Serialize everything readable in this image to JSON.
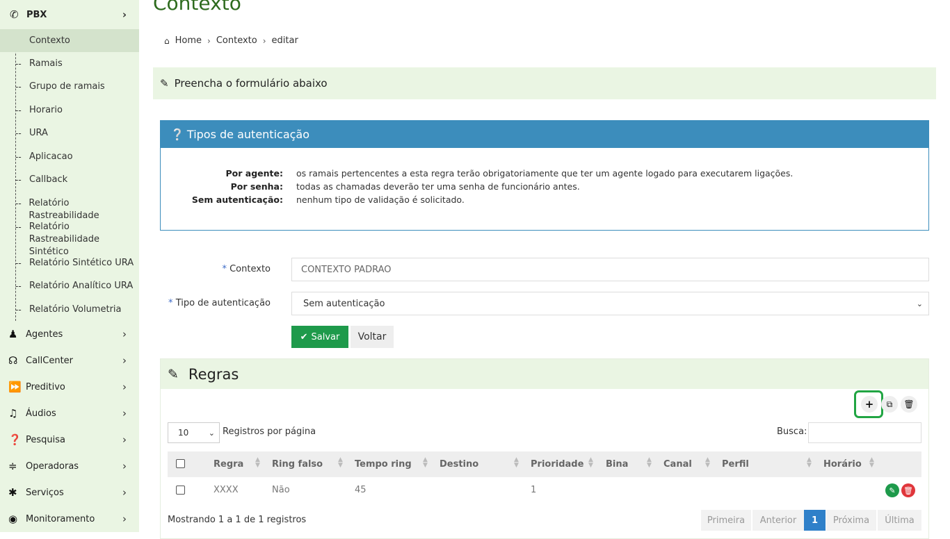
{
  "page_title": "Contexto",
  "breadcrumb": {
    "home": "Home",
    "section": "Contexto",
    "current": "editar"
  },
  "sidebar": {
    "pbx_label": "PBX",
    "sub_items": [
      {
        "label": "Contexto"
      },
      {
        "label": "Ramais"
      },
      {
        "label": "Grupo de ramais"
      },
      {
        "label": "Horario"
      },
      {
        "label": "URA"
      },
      {
        "label": "Aplicacao"
      },
      {
        "label": "Callback"
      },
      {
        "label": "Relatório Rastreabilidade"
      },
      {
        "label": "Relatório Rastreabilidade Sintético"
      },
      {
        "label": "Relatório Sintético URA"
      },
      {
        "label": "Relatório Analítico URA"
      },
      {
        "label": "Relatório Volumetria"
      }
    ],
    "menu_items": [
      {
        "label": "Agentes",
        "icon": "person-icon"
      },
      {
        "label": "CallCenter",
        "icon": "headset-icon"
      },
      {
        "label": "Preditivo",
        "icon": "fast-forward-icon"
      },
      {
        "label": "Áudios",
        "icon": "music-icon"
      },
      {
        "label": "Pesquisa",
        "icon": "question-icon"
      },
      {
        "label": "Operadoras",
        "icon": "rss-icon"
      },
      {
        "label": "Serviços",
        "icon": "asterisk-icon"
      },
      {
        "label": "Monitoramento",
        "icon": "eye-icon"
      }
    ]
  },
  "form_banner": "Preencha o formulário abaixo",
  "auth_info": {
    "title": "Tipos de autenticação",
    "rows": [
      {
        "label": "Por agente:",
        "desc": "os ramais pertencentes a esta regra terão obrigatoriamente que ter um agente logado para executarem ligações."
      },
      {
        "label": "Por senha:",
        "desc": "todas as chamadas deverão ter uma senha de funcionário antes."
      },
      {
        "label": "Sem autenticação:",
        "desc": "nenhum tipo de validação é solicitado."
      }
    ]
  },
  "form": {
    "required_mark": "*",
    "contexto_label": "Contexto",
    "contexto_value": "CONTEXTO PADRAO",
    "tipo_label": "Tipo de autenticação",
    "tipo_value": "Sem autenticação",
    "save_label": "Salvar",
    "back_label": "Voltar"
  },
  "rules": {
    "title": "Regras",
    "per_page_value": "10",
    "per_page_label": "Registros por página",
    "search_label": "Busca:",
    "columns": [
      "Regra",
      "Ring falso",
      "Tempo ring",
      "Destino",
      "Prioridade",
      "Bina",
      "Canal",
      "Perfil",
      "Horário"
    ],
    "rows": [
      {
        "regra": "XXXX",
        "ring_falso": "Não",
        "tempo_ring": "45",
        "destino": "",
        "prioridade": "1",
        "bina": "",
        "canal": "",
        "perfil": "",
        "horario": ""
      }
    ],
    "showing": "Mostrando 1 a 1 de 1 registros",
    "pagination": {
      "first": "Primeira",
      "prev": "Anterior",
      "current": "1",
      "next": "Próxima",
      "last": "Última"
    }
  },
  "colors": {
    "accent_green": "#1e9a4b",
    "info_blue": "#3c8dbc",
    "sidebar_bg": "#eaf5e3",
    "title_green": "#2e6b1e",
    "highlight": "#21a543"
  }
}
